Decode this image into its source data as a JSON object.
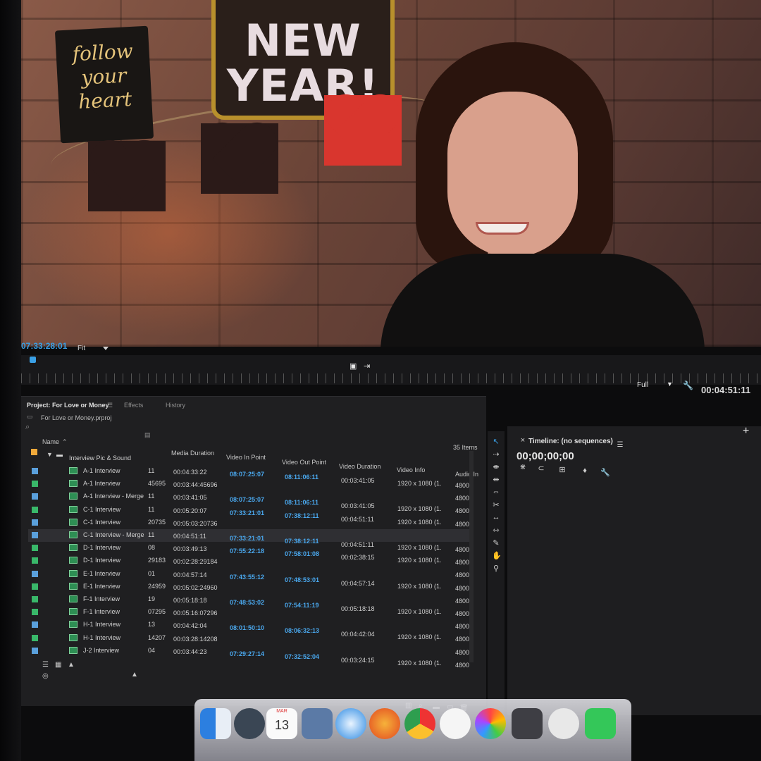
{
  "monitor": {
    "sign_follow": "follow your heart",
    "sign_year": "NEW YEAR!",
    "playhead_timecode": "07:33:28:01",
    "zoom": "Fit",
    "resolution": "Full",
    "duration_timecode": "00:04:51:11"
  },
  "panels": {
    "project_tab": "Project: For Love or Money",
    "effects_tab": "Effects",
    "history_tab": "History",
    "project_file": "For Love or Money.prproj",
    "items_count": "35 Items",
    "timeline_title": "Timeline: (no sequences)",
    "timeline_tc": "00;00;00;00"
  },
  "columns": {
    "name": "Name",
    "media_duration": "Media Duration",
    "video_in": "Video In Point",
    "video_out": "Video Out Point",
    "video_duration": "Video Duration",
    "video_info": "Video Info",
    "audio_in": "Audio In"
  },
  "folder": "Interview Pic & Sound",
  "rows": [
    {
      "name": "A-1 Interview",
      "c1": "11",
      "media": "00:04:33:22",
      "vin": "08:07:25:07",
      "vout": "08:11:06:11",
      "vdur": "00:03:41:05",
      "info": "1920 x 1080 (1.",
      "aud": "4800",
      "chip": "#5aa0dc"
    },
    {
      "name": "A-1 Interview",
      "c1": "45695",
      "media": "00:03:44:45696",
      "vin": "",
      "vout": "",
      "vdur": "",
      "info": "",
      "aud": "4800",
      "chip": "#39b86a"
    },
    {
      "name": "A-1 Interview - Merge",
      "c1": "11",
      "media": "00:03:41:05",
      "vin": "08:07:25:07",
      "vout": "08:11:06:11",
      "vdur": "00:03:41:05",
      "info": "1920 x 1080 (1.",
      "aud": "4800",
      "chip": "#5aa0dc"
    },
    {
      "name": "C-1 Interview",
      "c1": "11",
      "media": "00:05:20:07",
      "vin": "07:33:21:01",
      "vout": "07:38:12:11",
      "vdur": "00:04:51:11",
      "info": "1920 x 1080 (1.",
      "aud": "4800",
      "chip": "#39b86a"
    },
    {
      "name": "C-1 Interview",
      "c1": "20735",
      "media": "00:05:03:20736",
      "vin": "",
      "vout": "",
      "vdur": "",
      "info": "1920 x 1080 (1.",
      "aud": "4800",
      "chip": "#5aa0dc"
    },
    {
      "name": "C-1 Interview - Merge",
      "c1": "11",
      "media": "00:04:51:11",
      "vin": "07:33:21:01",
      "vout": "07:38:12:11",
      "vdur": "00:04:51:11",
      "info": "1920 x 1080 (1.",
      "aud": "4800",
      "chip": "#5aa0dc"
    },
    {
      "name": "D-1 Interview",
      "c1": "08",
      "media": "00:03:49:13",
      "vin": "07:55:22:18",
      "vout": "07:58:01:08",
      "vdur": "00:02:38:15",
      "info": "1920 x 1080 (1.",
      "aud": "4800",
      "chip": "#39b86a"
    },
    {
      "name": "D-1 Interview",
      "c1": "29183",
      "media": "00:02:28:29184",
      "vin": "",
      "vout": "",
      "vdur": "",
      "info": "",
      "aud": "4800",
      "chip": "#39b86a"
    },
    {
      "name": "E-1 Interview",
      "c1": "01",
      "media": "00:04:57:14",
      "vin": "07:43:55:12",
      "vout": "07:48:53:01",
      "vdur": "00:04:57:14",
      "info": "1920 x 1080 (1.",
      "aud": "4800",
      "chip": "#5aa0dc"
    },
    {
      "name": "E-1 Interview",
      "c1": "24959",
      "media": "00:05:02:24960",
      "vin": "",
      "vout": "",
      "vdur": "",
      "info": "",
      "aud": "4800",
      "chip": "#39b86a"
    },
    {
      "name": "F-1 Interview",
      "c1": "19",
      "media": "00:05:18:18",
      "vin": "07:48:53:02",
      "vout": "07:54:11:19",
      "vdur": "00:05:18:18",
      "info": "1920 x 1080 (1.",
      "aud": "4800",
      "chip": "#39b86a"
    },
    {
      "name": "F-1 Interview",
      "c1": "07295",
      "media": "00:05:16:07296",
      "vin": "",
      "vout": "",
      "vdur": "",
      "info": "",
      "aud": "4800",
      "chip": "#39b86a"
    },
    {
      "name": "H-1 Interview",
      "c1": "13",
      "media": "00:04:42:04",
      "vin": "08:01:50:10",
      "vout": "08:06:32:13",
      "vdur": "00:04:42:04",
      "info": "1920 x 1080 (1.",
      "aud": "4800",
      "chip": "#5aa0dc"
    },
    {
      "name": "H-1 Interview",
      "c1": "14207",
      "media": "00:03:28:14208",
      "vin": "",
      "vout": "",
      "vdur": "",
      "info": "",
      "aud": "4800",
      "chip": "#39b86a"
    },
    {
      "name": "J-2 Interview",
      "c1": "04",
      "media": "00:03:44:23",
      "vin": "07:29:27:14",
      "vout": "07:32:52:04",
      "vdur": "00:03:24:15",
      "info": "1920 x 1080 (1.",
      "aud": "4800",
      "chip": "#5aa0dc"
    }
  ],
  "dock": {
    "calendar_month": "MAR",
    "calendar_day": "13"
  }
}
